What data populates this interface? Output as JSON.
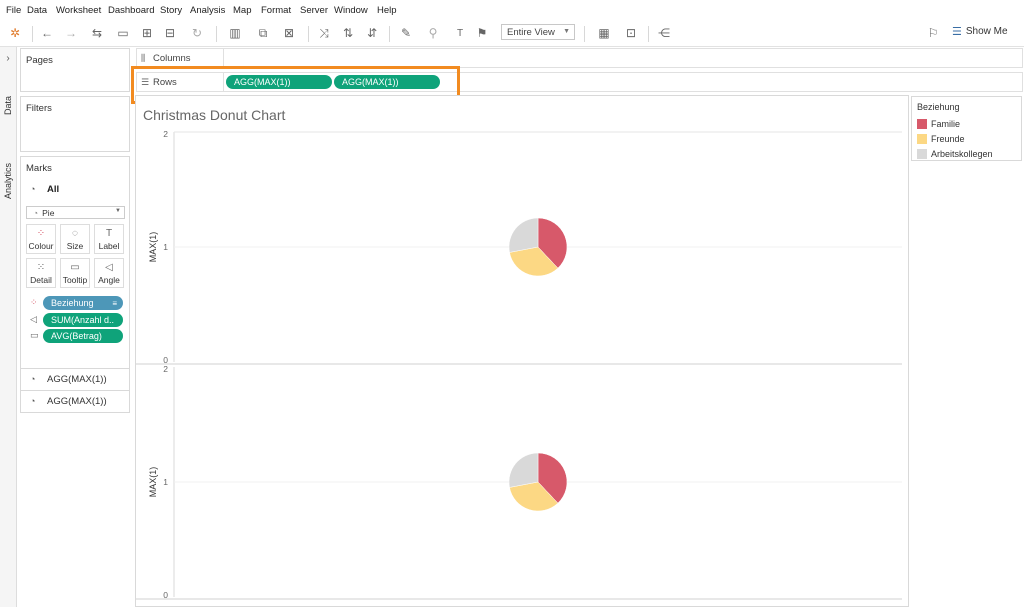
{
  "menu": [
    "File",
    "Data",
    "Worksheet",
    "Dashboard",
    "Story",
    "Analysis",
    "Map",
    "Format",
    "Server",
    "Window",
    "Help"
  ],
  "toolbar": {
    "fit_value": "Entire View",
    "show_me": "Show Me"
  },
  "side_tabs": {
    "data": "Data",
    "analytics": "Analytics"
  },
  "panels": {
    "pages": "Pages",
    "filters": "Filters",
    "marks": "Marks"
  },
  "marks": {
    "all_label": "All",
    "mark_type": "Pie",
    "buttons": [
      "Colour",
      "Size",
      "Label",
      "Detail",
      "Tooltip",
      "Angle"
    ],
    "fields": [
      "Beziehung",
      "SUM(Anzahl d..",
      "AVG(Betrag)"
    ],
    "sub_cards": [
      "AGG(MAX(1))",
      "AGG(MAX(1))"
    ]
  },
  "shelves": {
    "columns_label": "Columns",
    "rows_label": "Rows",
    "rows_pills": [
      "AGG(MAX(1))",
      "AGG(MAX(1))"
    ]
  },
  "chart_title": "Christmas Donut Chart",
  "legend": {
    "title": "Beziehung",
    "items": [
      {
        "label": "Familie",
        "color": "#d7596a"
      },
      {
        "label": "Freunde",
        "color": "#fcd884"
      },
      {
        "label": "Arbeitskollegen",
        "color": "#d9d9d9"
      }
    ]
  },
  "chart_data": {
    "type": "pie",
    "panes": [
      {
        "ylabel": "MAX(1)",
        "ylim": [
          0,
          2
        ],
        "y_ticks": [
          "2",
          "1",
          "0"
        ],
        "y": 1,
        "slices": [
          {
            "name": "Familie",
            "value": 38
          },
          {
            "name": "Freunde",
            "value": 34
          },
          {
            "name": "Arbeitskollegen",
            "value": 28
          }
        ]
      },
      {
        "ylabel": "MAX(1)",
        "ylim": [
          0,
          2
        ],
        "y_ticks": [
          "2",
          "1",
          "0"
        ],
        "y": 1,
        "slices": [
          {
            "name": "Familie",
            "value": 38
          },
          {
            "name": "Freunde",
            "value": 34
          },
          {
            "name": "Arbeitskollegen",
            "value": 28
          }
        ]
      }
    ],
    "colors": {
      "Familie": "#d7596a",
      "Freunde": "#fcd884",
      "Arbeitskollegen": "#d9d9d9"
    }
  }
}
